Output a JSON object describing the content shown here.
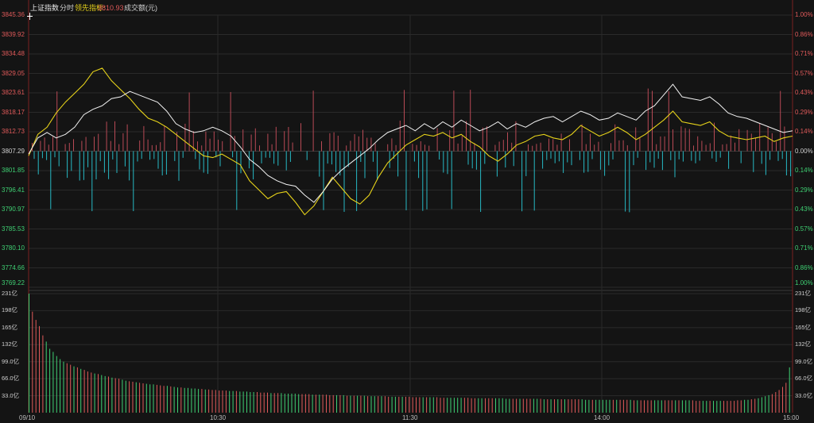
{
  "header": {
    "index_name": "上证指数",
    "mode": "分时",
    "leading_label": "领先指标:",
    "leading_value": "3810.93",
    "volume_label": "成交额(元)"
  },
  "colors": {
    "background": "#141414",
    "up": "#e05a5a",
    "down": "#3fd073",
    "index_line": "#f2f2f2",
    "leading_line": "#e6d21a",
    "down_bar": "#27b8c4",
    "grid": "#2a2a2a"
  },
  "chart_data": [
    {
      "type": "line",
      "name": "price-chart",
      "y_left_ticks": [
        "3845.36",
        "3839.92",
        "3834.48",
        "3829.05",
        "3823.61",
        "3818.17",
        "3812.73",
        "3807.29",
        "3801.85",
        "3796.41",
        "3790.97",
        "3785.53",
        "3780.10",
        "3774.66",
        "3769.22"
      ],
      "y_right_ticks": [
        "1.00%",
        "0.86%",
        "0.71%",
        "0.57%",
        "0.43%",
        "0.29%",
        "0.14%",
        "0.00%",
        "0.14%",
        "0.29%",
        "0.43%",
        "0.57%",
        "0.71%",
        "0.86%",
        "1.00%"
      ],
      "ylim": [
        3769.22,
        3845.36
      ],
      "base": 3807.29,
      "x_ticks": [
        "09/10",
        "10:30",
        "11:30",
        "14:00",
        "15:00"
      ],
      "series": [
        {
          "key": "index",
          "values": [
            3806.5,
            3811.0,
            3812.5,
            3811.0,
            3812.0,
            3814.0,
            3817.5,
            3819.0,
            3820.0,
            3822.0,
            3822.5,
            3824.0,
            3823.0,
            3822.0,
            3821.0,
            3818.5,
            3815.0,
            3813.5,
            3812.5,
            3813.0,
            3814.0,
            3813.0,
            3811.5,
            3808.5,
            3805.0,
            3803.0,
            3800.5,
            3799.0,
            3798.0,
            3797.5,
            3795.0,
            3793.0,
            3796.0,
            3799.5,
            3802.0,
            3804.0,
            3806.0,
            3808.0,
            3810.5,
            3812.5,
            3813.5,
            3814.5,
            3813.0,
            3815.0,
            3813.5,
            3815.5,
            3814.0,
            3816.0,
            3814.5,
            3813.0,
            3814.0,
            3815.5,
            3813.5,
            3815.0,
            3814.0,
            3815.5,
            3816.5,
            3817.0,
            3815.5,
            3817.0,
            3818.5,
            3817.5,
            3816.0,
            3816.5,
            3818.0,
            3817.0,
            3816.0,
            3818.5,
            3820.0,
            3823.0,
            3826.0,
            3822.5,
            3822.0,
            3821.5,
            3822.5,
            3820.5,
            3818.0,
            3817.0,
            3816.5,
            3815.5,
            3814.5,
            3813.5,
            3812.5,
            3813.0
          ]
        },
        {
          "key": "leading",
          "values": [
            3806.0,
            3812.0,
            3814.0,
            3818.0,
            3821.0,
            3823.5,
            3826.0,
            3829.5,
            3830.5,
            3827.0,
            3824.5,
            3822.0,
            3819.0,
            3816.5,
            3815.5,
            3814.0,
            3812.0,
            3810.0,
            3808.0,
            3806.0,
            3805.5,
            3806.5,
            3805.0,
            3803.5,
            3799.0,
            3796.5,
            3794.0,
            3795.5,
            3796.0,
            3793.0,
            3789.5,
            3792.0,
            3796.0,
            3800.0,
            3797.0,
            3794.0,
            3792.5,
            3795.0,
            3800.0,
            3804.0,
            3806.5,
            3809.0,
            3810.5,
            3812.0,
            3811.5,
            3812.5,
            3811.0,
            3812.0,
            3810.0,
            3808.5,
            3806.0,
            3804.5,
            3806.5,
            3809.0,
            3810.0,
            3811.5,
            3812.0,
            3811.0,
            3810.5,
            3812.0,
            3814.5,
            3813.0,
            3811.5,
            3812.5,
            3814.0,
            3812.5,
            3810.5,
            3812.0,
            3814.0,
            3816.0,
            3818.5,
            3815.5,
            3815.0,
            3814.5,
            3815.5,
            3813.0,
            3811.5,
            3811.0,
            3810.5,
            3811.0,
            3811.5,
            3810.0,
            3811.0,
            3811.5
          ]
        }
      ]
    },
    {
      "type": "bar",
      "name": "amount-chart",
      "y_ticks": [
        "231亿",
        "198亿",
        "165亿",
        "132亿",
        "99.0亿",
        "66.0亿",
        "33.0亿"
      ],
      "ylim": [
        0,
        231
      ],
      "values": [
        231,
        196,
        180,
        168,
        150,
        138,
        124,
        118,
        110,
        104,
        99,
        96,
        93,
        90,
        88,
        85,
        83,
        80,
        78,
        76,
        75,
        73,
        71,
        70,
        68,
        67,
        66,
        64,
        62,
        61,
        60,
        59,
        58,
        57,
        56,
        55,
        55,
        54,
        53,
        52,
        52,
        51,
        50,
        49,
        49,
        48,
        48,
        47,
        47,
        46,
        46,
        45,
        45,
        44,
        44,
        43,
        43,
        43,
        42,
        42,
        42,
        41,
        41,
        41,
        40,
        40,
        40,
        39,
        39,
        39,
        38,
        38,
        38,
        38,
        37,
        37,
        37,
        37,
        36,
        36,
        36,
        36,
        35,
        35,
        35,
        35,
        35,
        34,
        34,
        34,
        34,
        34,
        33,
        33,
        33,
        33,
        33,
        33,
        32,
        32,
        32,
        32,
        32,
        32,
        31,
        31,
        31,
        31,
        31,
        31,
        31,
        30,
        30,
        30,
        30,
        30,
        30,
        30,
        30,
        29,
        29,
        29,
        29,
        29,
        29,
        29,
        29,
        29,
        28,
        28,
        28,
        28,
        28,
        28,
        28,
        28,
        28,
        28,
        27,
        27,
        27,
        27,
        27,
        27,
        27,
        27,
        27,
        27,
        27,
        26,
        26,
        26,
        26,
        26,
        26,
        26,
        26,
        26,
        26,
        26,
        26,
        25,
        25,
        25,
        25,
        25,
        25,
        25,
        25,
        25,
        25,
        25,
        25,
        25,
        25,
        24,
        24,
        24,
        24,
        24,
        24,
        24,
        24,
        24,
        24,
        24,
        24,
        24,
        24,
        24,
        24,
        24,
        24,
        23,
        23,
        23,
        23,
        23,
        23,
        23,
        23,
        23,
        23,
        23,
        23,
        24,
        24,
        25,
        25,
        26,
        27,
        28,
        30,
        32,
        34,
        36,
        40,
        44,
        50,
        58,
        88
      ]
    }
  ]
}
